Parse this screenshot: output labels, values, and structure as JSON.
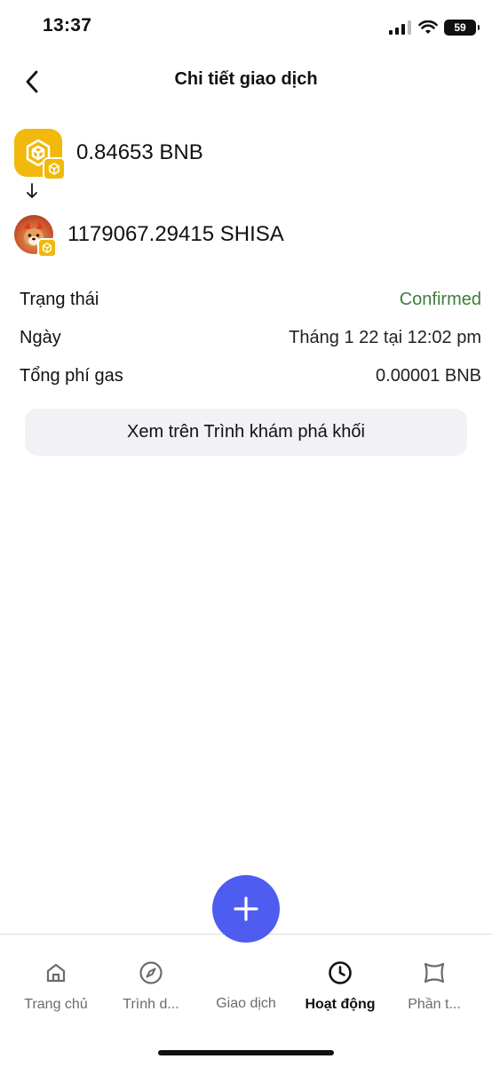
{
  "status_bar": {
    "time": "13:37",
    "battery": "59"
  },
  "header": {
    "title": "Chi tiết giao dịch"
  },
  "transaction": {
    "from_amount": "0.84653 BNB",
    "to_amount": "1179067.29415 SHISA",
    "rows": [
      {
        "label": "Trạng thái",
        "value": "Confirmed"
      },
      {
        "label": "Ngày",
        "value": "Tháng 1 22 tại 12:02 pm"
      },
      {
        "label": "Tổng phí gas",
        "value": "0.00001 BNB"
      }
    ],
    "status_color": "#3e7d3a"
  },
  "explorer_button": {
    "label": "Xem trên Trình khám phá khối"
  },
  "tab_bar": {
    "home": "Trang chủ",
    "browser": "Trình d...",
    "trade": "Giao dịch",
    "activity": "Hoạt động",
    "nft": "Phần t..."
  },
  "colors": {
    "accent": "#4f5cf0",
    "bnb": "#f0b90b"
  },
  "icons": [
    "back-icon",
    "bnb-icon",
    "shisa-icon",
    "arrow-down-icon",
    "home-icon",
    "compass-icon",
    "plus-icon",
    "clock-icon",
    "nft-icon"
  ]
}
